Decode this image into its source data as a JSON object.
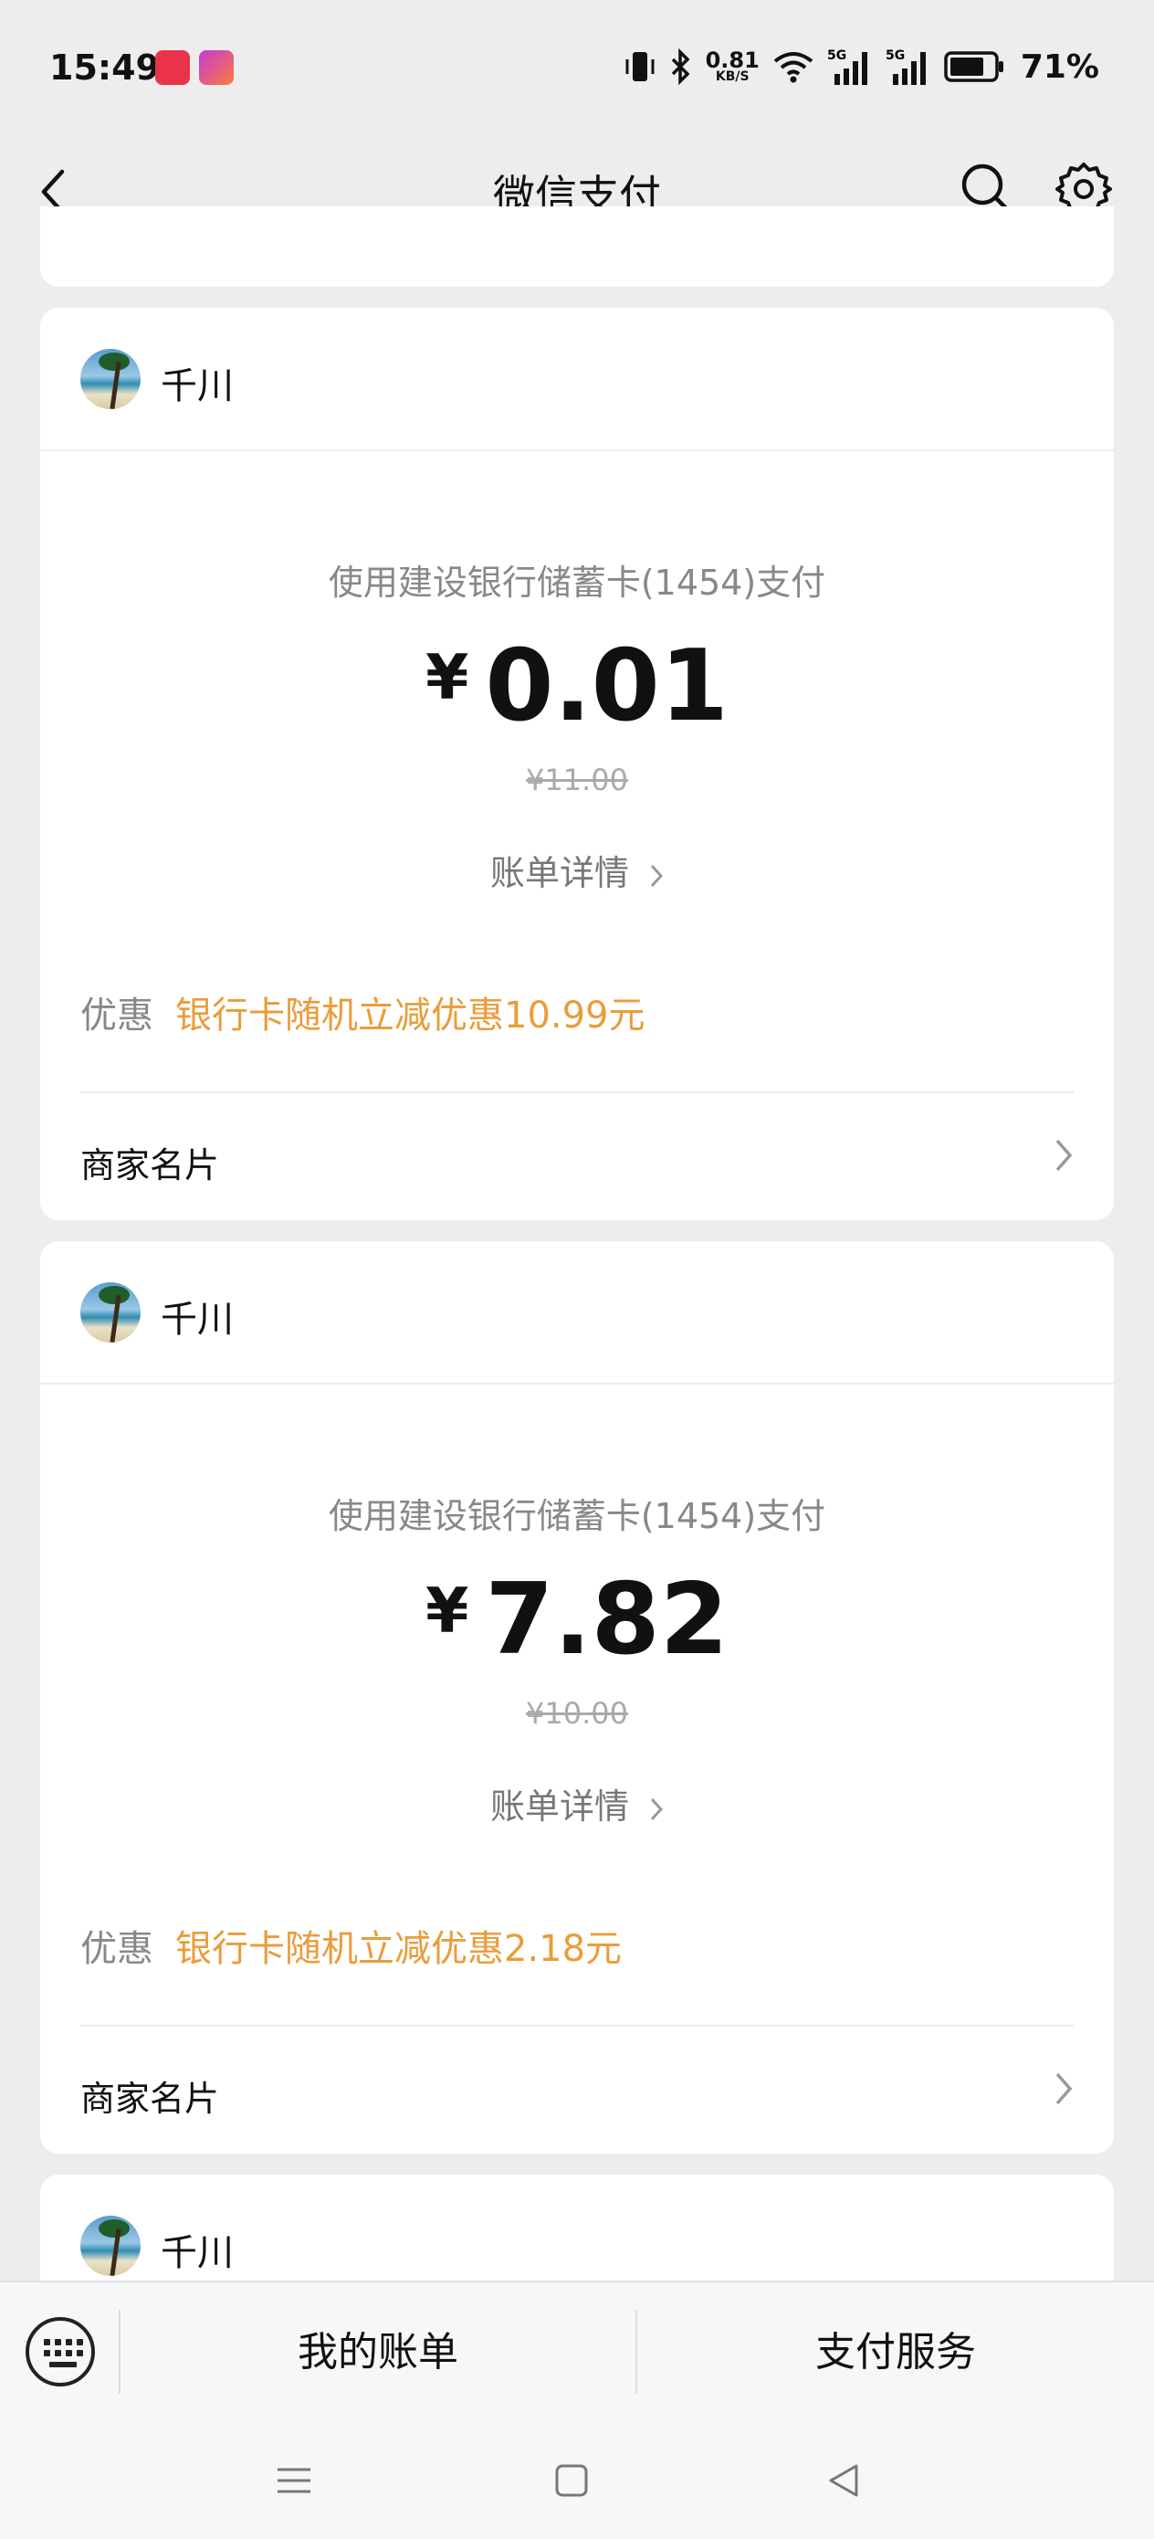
{
  "status_bar": {
    "time": "15:49",
    "speed_value": "0.81",
    "speed_unit": "KB/S",
    "battery": "71%"
  },
  "nav": {
    "title": "微信支付",
    "icons": [
      "back-icon",
      "search-icon",
      "settings-icon"
    ]
  },
  "transactions": [
    {
      "merchant": "千川",
      "pay_method": "使用建设银行储蓄卡(1454)支付",
      "currency": "¥",
      "amount": "0.01",
      "original_price": "¥11.00",
      "bill_detail": "账单详情",
      "discount_label": "优惠",
      "discount_value": "银行卡随机立减优惠10.99元",
      "merchant_card": "商家名片"
    },
    {
      "merchant": "千川",
      "pay_method": "使用建设银行储蓄卡(1454)支付",
      "currency": "¥",
      "amount": "7.82",
      "original_price": "¥10.00",
      "bill_detail": "账单详情",
      "discount_label": "优惠",
      "discount_value": "银行卡随机立减优惠2.18元",
      "merchant_card": "商家名片"
    },
    {
      "merchant": "千川"
    }
  ],
  "bottom_menu": {
    "my_bills": "我的账单",
    "pay_services": "支付服务"
  },
  "colors": {
    "discount": "#ea9c3b",
    "background": "#ededed"
  }
}
